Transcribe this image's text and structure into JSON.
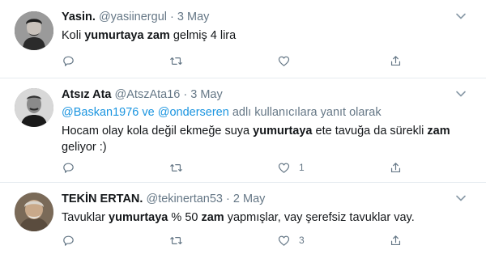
{
  "colors": {
    "text": "#14171a",
    "muted": "#657786",
    "link": "#1b95e0",
    "divider": "#e6ecf0"
  },
  "tweets": [
    {
      "name": "Yasin.",
      "handle": "@yasiinergul",
      "separator": "·",
      "date": "3 May",
      "text": {
        "p1": "Koli ",
        "b1": "yumurtaya zam",
        "p2": " gelmiş 4 lira"
      },
      "actions": {
        "reply": "",
        "retweet": "",
        "like": "",
        "share": ""
      }
    },
    {
      "name": "Atsız Ata",
      "handle": "@AtszAta16",
      "separator": "·",
      "date": "3 May",
      "reply_to": {
        "user1": "@Baskan1976",
        "joiner": " ve ",
        "user2": "@onderseren",
        "suffix": " adlı kullanıcılara yanıt olarak"
      },
      "text": {
        "p1": "Hocam olay kola değil ekmeğe suya ",
        "b1": "yumurtaya",
        "p2": " ete tavuğa da sürekli ",
        "b2": "zam",
        "p3": " geliyor :)"
      },
      "actions": {
        "reply": "",
        "retweet": "",
        "like": "1",
        "share": ""
      }
    },
    {
      "name": "TEKİN ERTAN.",
      "handle": "@tekinertan53",
      "separator": "·",
      "date": "2 May",
      "text": {
        "p1": "Tavuklar ",
        "b1": "yumurtaya",
        "p2": " % 50 ",
        "b2": "zam",
        "p3": " yapmışlar, vay şerefsiz tavuklar vay."
      },
      "actions": {
        "reply": "",
        "retweet": "",
        "like": "3",
        "share": ""
      }
    }
  ]
}
